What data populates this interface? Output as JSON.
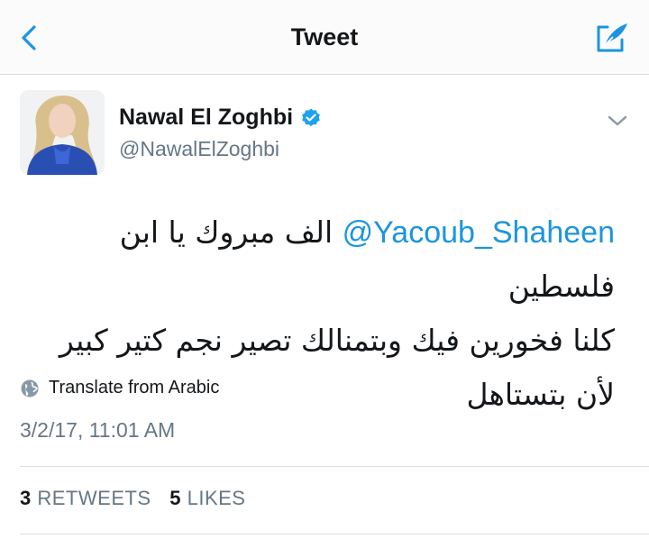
{
  "nav": {
    "title": "Tweet"
  },
  "author": {
    "name": "Nawal El Zoghbi",
    "handle": "@NawalElZoghbi",
    "verified": true
  },
  "tweet": {
    "mention": "@Yacoub_Shaheen",
    "text_line1": " الف مبروك يا ابن فلسطين",
    "text_rest": "كلنا فخورين فيك وبتمنالك تصير نجم كتير كبير لأن بتستاهل"
  },
  "translate": {
    "label": "Translate from Arabic"
  },
  "timestamp": "3/2/17, 11:01 AM",
  "stats": {
    "retweets_count": "3",
    "retweets_label": "RETWEETS",
    "likes_count": "5",
    "likes_label": "LIKES"
  },
  "colors": {
    "accent": "#1b95e0",
    "secondary_text": "#657786",
    "divider": "#d9dee2"
  },
  "icons": {
    "back": "chevron-left-icon",
    "compose": "compose-icon",
    "verified": "verified-badge-icon",
    "caret": "chevron-down-icon",
    "translate": "globe-icon"
  }
}
